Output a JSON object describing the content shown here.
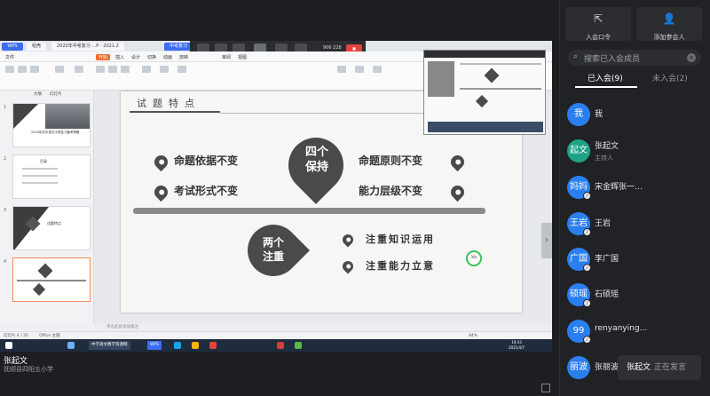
{
  "sidebar": {
    "join_code_label": "入会口令",
    "add_member_label": "添加参会人",
    "search_placeholder": "搜索已入会成员",
    "tabs": [
      {
        "label": "已入会(9)"
      },
      {
        "label": "未入会(2)"
      }
    ],
    "members": [
      {
        "avatar": "我",
        "name": "我",
        "role": ""
      },
      {
        "avatar": "起文",
        "name": "张起文",
        "role": "主持人"
      },
      {
        "avatar": "妈妈",
        "name": "宋金辉张一…",
        "role": ""
      },
      {
        "avatar": "王岩",
        "name": "王岩",
        "role": ""
      },
      {
        "avatar": "广国",
        "name": "李广国",
        "role": ""
      },
      {
        "avatar": "硕瑶",
        "name": "石硕瑶",
        "role": ""
      },
      {
        "avatar": "99",
        "name": "renyanying...",
        "role": ""
      },
      {
        "avatar": "丽波",
        "name": "张丽波",
        "role": ""
      }
    ]
  },
  "speaking": {
    "name": "张起文",
    "status": "正在发言"
  },
  "presenter": {
    "name": "张起文",
    "org": "抚顺县四阳五小学"
  },
  "share": {
    "meeting_id": "906 228",
    "wps_tabs": [
      "稻壳",
      "2020年中考复习-...P - 2021.2",
      "中考复习"
    ],
    "menus": [
      "文件",
      "开始",
      "插入",
      "设计",
      "切换",
      "动画",
      "放映",
      "审阅",
      "视图"
    ],
    "thumb_tabs": [
      "大纲",
      "幻灯片"
    ],
    "notes_placeholder": "单击此处添加备注",
    "status_left": "幻灯片 4 / 20",
    "status_theme": "Office 主题",
    "zoom": "84%",
    "clock_time": "10:43",
    "clock_date": "2021/4/7",
    "taskbar_apps": [
      "中学语文教学资源网",
      "WPS"
    ],
    "slide": {
      "title": "试题特点",
      "center": "四个\n保持",
      "left_items": [
        "命题依据不变",
        "考试形式不变"
      ],
      "right_items": [
        "命题原则不变",
        "能力层级不变"
      ],
      "bottom_center": "两个\n注重",
      "bottom_items": [
        "注重知识运用",
        "注重能力立意"
      ],
      "timer": "30s",
      "thumb_titles": [
        "2020年初中语文中考复习备考策略",
        "目录",
        "试题特点"
      ]
    }
  }
}
